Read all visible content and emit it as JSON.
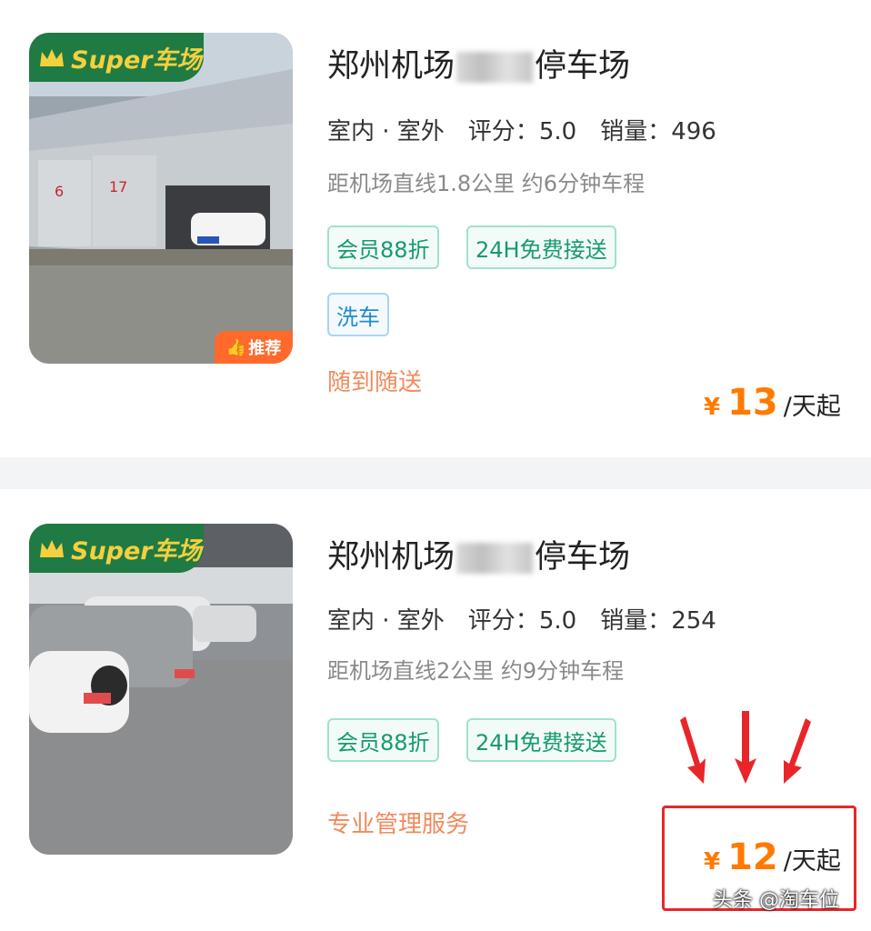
{
  "listings": [
    {
      "badge": "Super车场",
      "recommend": "推荐",
      "title_start": "郑州机场",
      "title_end": "停车场",
      "type": "室内 · 室外",
      "rating_label": "评分：",
      "rating": "5.0",
      "sales_label": "销量：",
      "sales": "496",
      "distance": "距机场直线1.8公里 约6分钟车程",
      "tags": [
        "会员88折",
        "24H免费接送",
        "洗车"
      ],
      "service": "随到随送",
      "currency": "¥",
      "price": "13",
      "unit": "/天起"
    },
    {
      "badge": "Super车场",
      "title_start": "郑州机场",
      "title_end": "停车场",
      "type": "室内 · 室外",
      "rating_label": "评分：",
      "rating": "5.0",
      "sales_label": "销量：",
      "sales": "254",
      "distance": "距机场直线2公里 约9分钟车程",
      "tags": [
        "会员88折",
        "24H免费接送"
      ],
      "service": "专业管理服务",
      "currency": "¥",
      "price": "12",
      "unit": "/天起"
    }
  ],
  "watermark": "头条 @淘车位",
  "colors": {
    "accent_green": "#1f7a43",
    "price_orange": "#ff7a00",
    "highlight_red": "#e8262a"
  }
}
